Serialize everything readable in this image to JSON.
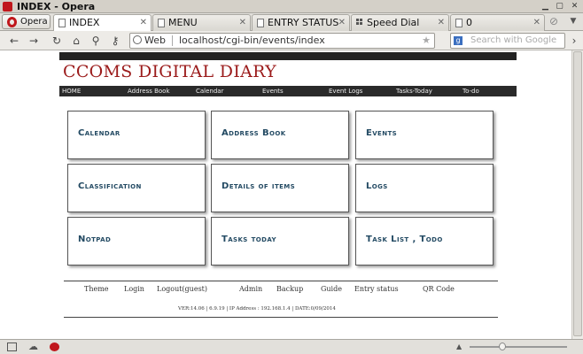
{
  "window": {
    "title": "INDEX - Opera"
  },
  "tabs_bar": {
    "opera_button": "Opera",
    "tabs": [
      {
        "label": "INDEX",
        "active": true
      },
      {
        "label": "MENU",
        "active": false
      },
      {
        "label": "ENTRY STATUS",
        "active": false
      },
      {
        "label": "Speed Dial",
        "active": false
      },
      {
        "label": "0",
        "active": false
      }
    ]
  },
  "address_bar": {
    "badge": "Web",
    "url": "localhost/cgi-bin/events/index",
    "search_placeholder": "Search with Google"
  },
  "page": {
    "site_title": "CCOMS DIGITAL DIARY",
    "nav": [
      "HOME",
      "Address Book",
      "Calendar",
      "Events",
      "Event Logs",
      "Tasks-Today",
      "To-do"
    ],
    "tiles": [
      {
        "label": "Calendar"
      },
      {
        "label": "Address Book"
      },
      {
        "label": "Events"
      },
      {
        "label": "Classification"
      },
      {
        "label": "Details of items"
      },
      {
        "label": "Logs"
      },
      {
        "label": "Notpad"
      },
      {
        "label": "Tasks today"
      },
      {
        "label": "Task List , Todo"
      }
    ],
    "footer_links": [
      "Theme",
      "Login",
      "Logout(guest)",
      "Admin",
      "Backup",
      "Guide",
      "Entry status",
      "QR Code"
    ],
    "footer_info": "VER:14.06 | 6.9.19 | IP Address : 192.168.1.4 | DATE:0/09/2014"
  },
  "colors": {
    "title_red": "#9b1b1b",
    "tile_text": "#234a63",
    "nav_bg": "#2a2a2a"
  }
}
